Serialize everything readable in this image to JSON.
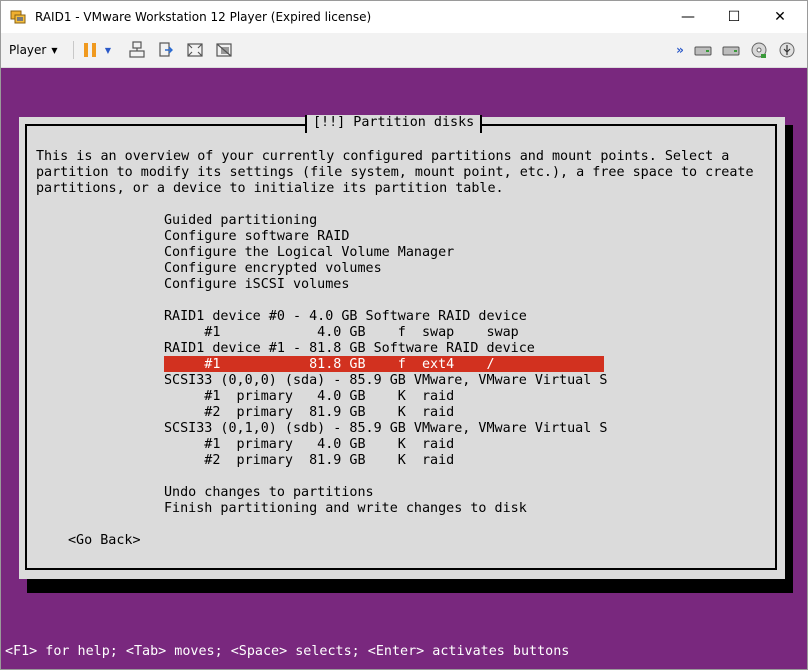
{
  "window": {
    "title": "RAID1 - VMware Workstation 12 Player (Expired license)",
    "controls": {
      "minimize": "—",
      "maximize": "☐",
      "close": "✕"
    }
  },
  "toolbar": {
    "player_label": "Player",
    "icons": [
      "pause-icon",
      "send-ctrl-alt-del-icon",
      "removable-devices-icon",
      "fit-window-icon",
      "unity-icon",
      "expand-arrows-icon",
      "hard-disk-icon",
      "network-adapter-icon",
      "cd-dvd-icon",
      "usb-device-icon"
    ]
  },
  "colors": {
    "vm_background": "#79287e",
    "dialog_background": "#dbdbdb",
    "selection": "#d2311f",
    "title_red": "#cc2a2a"
  },
  "installer": {
    "dialog_title": "[!!] Partition disks",
    "intro": [
      "This is an overview of your currently configured partitions and mount points. Select a",
      "partition to modify its settings (file system, mount point, etc.), a free space to create",
      "partitions, or a device to initialize its partition table."
    ],
    "menu": [
      "Guided partitioning",
      "Configure software RAID",
      "Configure the Logical Volume Manager",
      "Configure encrypted volumes",
      "Configure iSCSI volumes"
    ],
    "devices": [
      "RAID1 device #0 - 4.0 GB Software RAID device",
      "     #1            4.0 GB    f  swap    swap",
      "RAID1 device #1 - 81.8 GB Software RAID device",
      "     #1           81.8 GB    f  ext4    /",
      "SCSI33 (0,0,0) (sda) - 85.9 GB VMware, VMware Virtual S",
      "     #1  primary   4.0 GB    K  raid",
      "     #2  primary  81.9 GB    K  raid",
      "SCSI33 (0,1,0) (sdb) - 85.9 GB VMware, VMware Virtual S",
      "     #1  primary   4.0 GB    K  raid",
      "     #2  primary  81.9 GB    K  raid"
    ],
    "actions": [
      "Undo changes to partitions",
      "Finish partitioning and write changes to disk"
    ],
    "go_back": "<Go Back>",
    "status_line": "<F1> for help; <Tab> moves; <Space> selects; <Enter> activates buttons"
  }
}
